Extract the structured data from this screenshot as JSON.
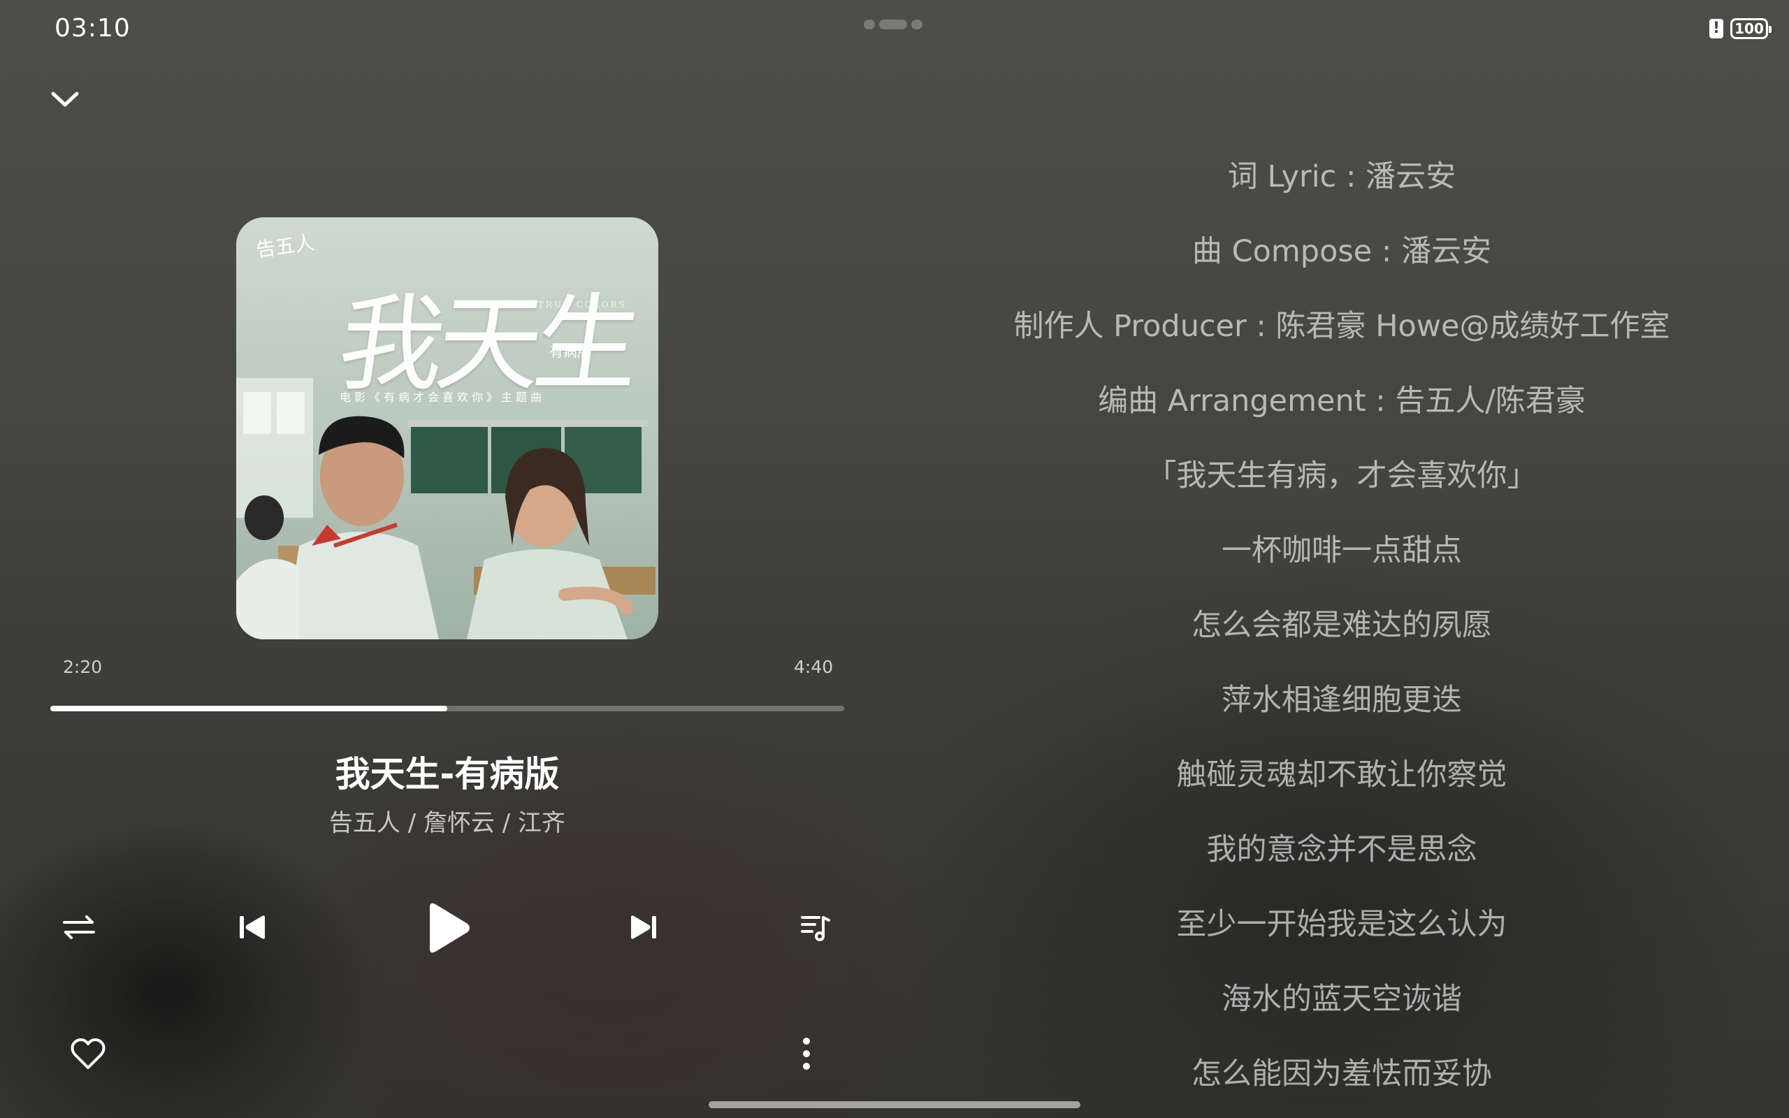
{
  "status_bar": {
    "time": "03:10",
    "battery": "100",
    "warning_icon": "alert-icon"
  },
  "player": {
    "collapse_icon": "chevron-down-icon",
    "album_art": {
      "logo": "告五人",
      "title": "我天生",
      "title_en": "TRUE COLORS",
      "subtitle": "有病版",
      "tagline": "电影《有病才会喜欢你》主题曲"
    },
    "current_time": "2:20",
    "total_time": "4:40",
    "progress": 0.5,
    "song_title": "我天生-有病版",
    "artists": "告五人 / 詹怀云 / 江齐",
    "controls": {
      "repeat_icon": "repeat-order-icon",
      "previous_icon": "skip-previous-icon",
      "play_icon": "play-icon",
      "next_icon": "skip-next-icon",
      "playlist_icon": "playlist-icon",
      "favorite_icon": "heart-icon",
      "more_icon": "more-vertical-icon"
    }
  },
  "lyrics": [
    "词 Lyric : 潘云安",
    "曲 Compose : 潘云安",
    "制作人 Producer : 陈君豪 Howe@成绩好工作室",
    "编曲 Arrangement : 告五人/陈君豪",
    "「我天生有病，才会喜欢你」",
    "一杯咖啡一点甜点",
    "怎么会都是难达的夙愿",
    "萍水相逢细胞更迭",
    "触碰灵魂却不敢让你察觉",
    "我的意念并不是思念",
    "至少一开始我是这么认为",
    "海水的蓝天空诙谐",
    "怎么能因为羞怯而妥协"
  ]
}
